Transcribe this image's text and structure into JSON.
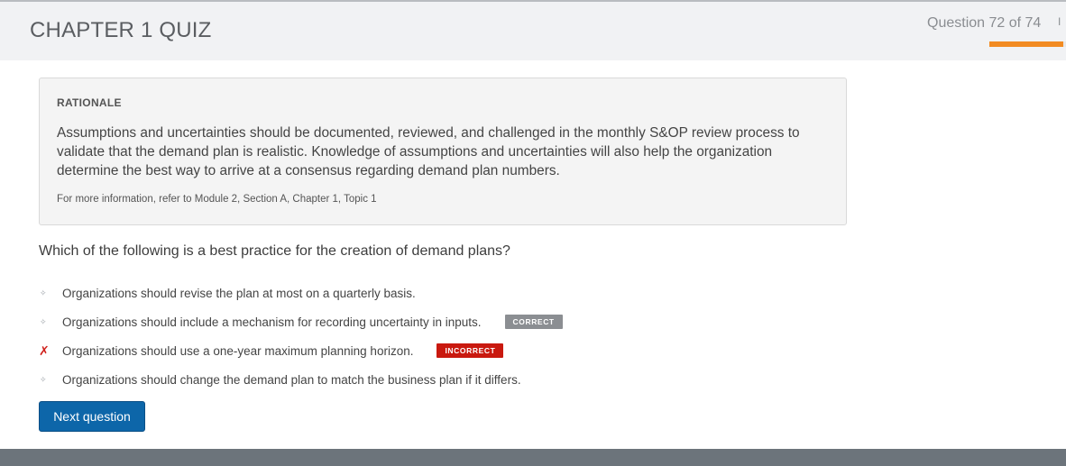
{
  "header": {
    "title": "CHAPTER 1 QUIZ",
    "progress_label": "Question 72 of 74",
    "progress_fraction": 0.97
  },
  "rationale": {
    "heading": "RATIONALE",
    "body": "Assumptions and uncertainties should be documented, reviewed, and challenged in the monthly S&OP review process to validate that the demand plan is realistic. Knowledge of assumptions and uncertainties will also help the organization determine the best way to arrive at a consensus regarding demand plan numbers.",
    "reference": "For more information, refer to Module 2, Section A, Chapter 1, Topic 1"
  },
  "question": {
    "text": "Which of the following is a best practice for the creation of demand plans?",
    "options": [
      {
        "text": "Organizations should revise the plan at most on a quarterly basis.",
        "marker": "✧",
        "badge": ""
      },
      {
        "text": "Organizations should include a mechanism for recording uncertainty in inputs.",
        "marker": "✧",
        "badge": "CORRECT"
      },
      {
        "text": "Organizations should use a one-year maximum planning horizon.",
        "marker": "✗",
        "badge": "INCORRECT"
      },
      {
        "text": "Organizations should change the demand plan to match the business plan if it differs.",
        "marker": "✧",
        "badge": ""
      }
    ]
  },
  "actions": {
    "next_label": "Next question"
  },
  "colors": {
    "accent": "#f28b22",
    "button": "#0d66a9",
    "correct_badge": "#8b8e92",
    "incorrect_badge": "#c9190f"
  }
}
